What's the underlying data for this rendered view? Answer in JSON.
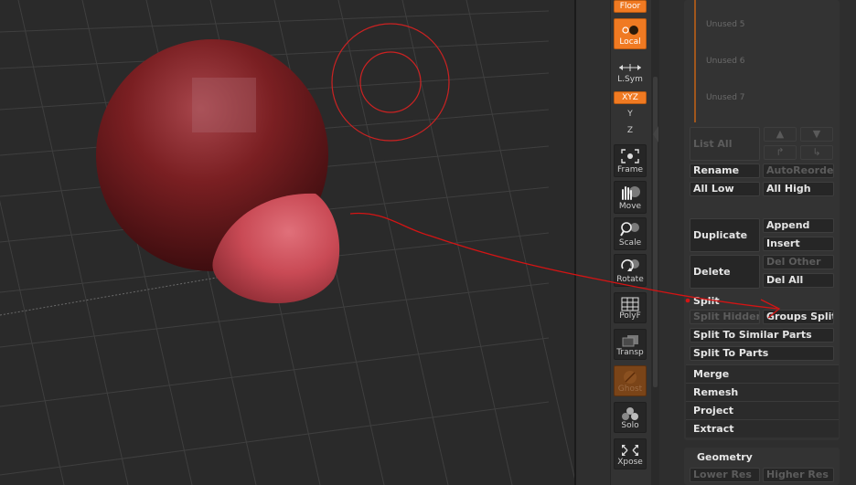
{
  "viewport": {
    "brush_color": "#cc2222",
    "arrow_color": "#d41414",
    "sphere_color": "#7a1f22",
    "part_color": "#c94a55"
  },
  "toolbar": {
    "floor": "Floor",
    "local": "Local",
    "lsym": "L.Sym",
    "xyz": "XYZ",
    "y_small": "Y",
    "z_small": "Z",
    "frame": "Frame",
    "move": "Move",
    "scale": "Scale",
    "rotate": "Rotate",
    "polyf": "PolyF",
    "transp": "Transp",
    "ghost": "Ghost",
    "solo": "Solo",
    "xpose": "Xpose"
  },
  "subtool_list": {
    "slots": [
      "Unused 5",
      "Unused 6",
      "Unused 7"
    ]
  },
  "subtool": {
    "list_all": "List All",
    "rename": "Rename",
    "auto_reorder": "AutoReorder",
    "all_low": "All Low",
    "all_high": "All High",
    "duplicate": "Duplicate",
    "append": "Append",
    "insert": "Insert",
    "delete": "Delete",
    "del_other": "Del Other",
    "del_all": "Del All",
    "split": "Split",
    "split_hidden": "Split Hidden",
    "groups_split": "Groups Split",
    "split_similar": "Split To Similar Parts",
    "split_parts": "Split To Parts",
    "merge": "Merge",
    "remesh": "Remesh",
    "project": "Project",
    "extract": "Extract"
  },
  "geometry": {
    "title": "Geometry",
    "lower_res": "Lower Res",
    "higher_res": "Higher Res"
  }
}
